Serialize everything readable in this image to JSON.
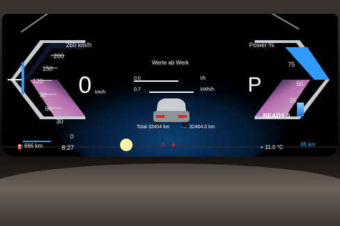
{
  "header": {
    "mode_title": "Werte ab Werk"
  },
  "speedometer": {
    "unit_top": "260 km/h",
    "ticks": [
      "200",
      "150",
      "120",
      "90",
      "60",
      "30",
      "0"
    ],
    "speed_value": "0",
    "speed_unit": "km/h"
  },
  "power": {
    "label": "Power %",
    "ticks": [
      "75",
      "50",
      "25"
    ],
    "ready_label": "READY 0",
    "gear": "P"
  },
  "consumption": {
    "row1_value": "0.0",
    "row1_unit": "l/h",
    "row2_value": "0.7",
    "row2_unit": "kWh/h"
  },
  "trip": {
    "total_label": "Total 32404 km",
    "trip_label": "32404.0 km"
  },
  "status": {
    "range": "666 km",
    "time": "8:27",
    "outside_temp": "+ 11.0 °C",
    "electric_range": "86 km"
  },
  "colors": {
    "accent_blue": "#2f9bff",
    "accent_pink": "#f3b7e6",
    "warning_red": "#e2232b",
    "indicator_yellow": "#fff3a6"
  }
}
